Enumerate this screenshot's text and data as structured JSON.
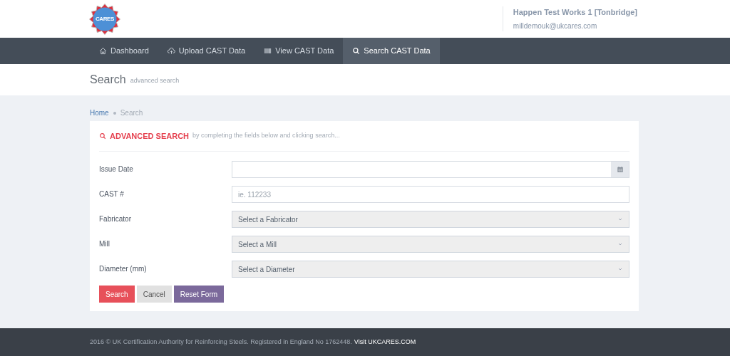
{
  "header": {
    "logo_text": "CARES",
    "user_name": "Happen Test Works 1 [Tonbridge]",
    "user_email": "milldemouk@ukcares.com"
  },
  "nav": [
    {
      "label": "Dashboard",
      "selected": false
    },
    {
      "label": "Upload CAST Data",
      "selected": false
    },
    {
      "label": "View CAST Data",
      "selected": false
    },
    {
      "label": "Search CAST Data",
      "selected": true
    }
  ],
  "page_title": {
    "title": "Search",
    "subtitle": "advanced search"
  },
  "breadcrumb": [
    "Home",
    "Search"
  ],
  "card": {
    "title": "ADVANCED SEARCH",
    "subtitle": "by completing the fields below and clicking search...",
    "fields": [
      {
        "label": "Issue Date",
        "kind": "date"
      },
      {
        "label": "CAST #",
        "kind": "text",
        "placeholder": "ie. 112233"
      },
      {
        "label": "Fabricator",
        "kind": "select",
        "value": "Select a Fabricator"
      },
      {
        "label": "Mill",
        "kind": "select",
        "value": "Select a Mill"
      },
      {
        "label": "Diameter (mm)",
        "kind": "select",
        "value": "Select a Diameter"
      }
    ],
    "buttons": [
      {
        "label": "Search",
        "kind": "danger"
      },
      {
        "label": "Cancel",
        "kind": "default"
      },
      {
        "label": "Reset Form",
        "kind": "purple"
      }
    ]
  },
  "footer": {
    "text": "2016 © UK Certification Authority for Reinforcing Steels. Registered in England No 1762448.",
    "link": "Visit UKCARES.COM"
  }
}
